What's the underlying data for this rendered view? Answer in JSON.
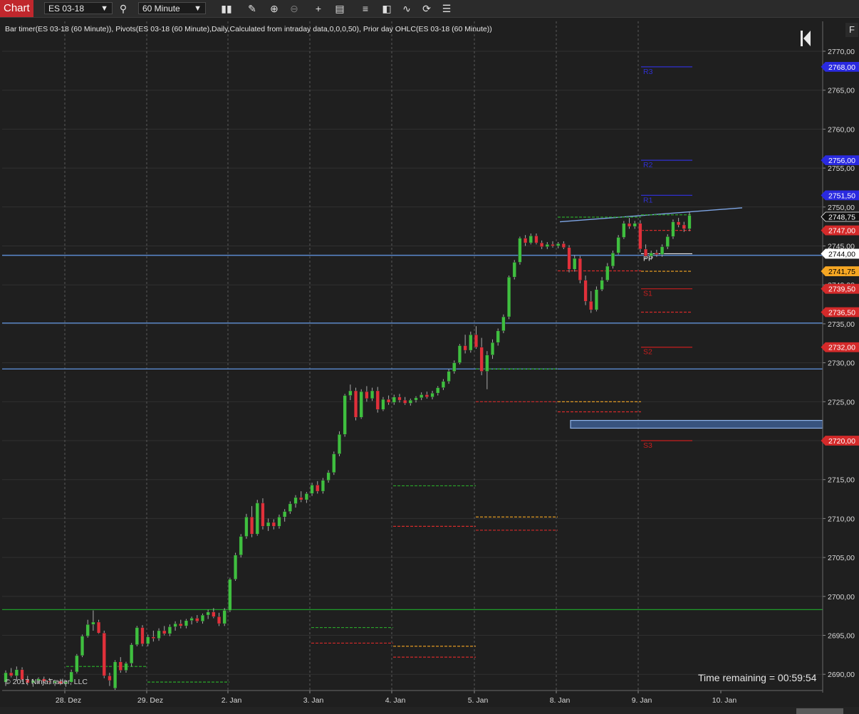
{
  "toolbar": {
    "tab_label": "Chart",
    "instrument": "ES 03-18",
    "interval": "60 Minute",
    "icons": [
      "search-icon",
      "bar-type-icon",
      "drawing-pencil-icon",
      "zoom-in-icon",
      "zoom-out-icon",
      "crosshair-icon",
      "properties-icon",
      "chart-trader-icon",
      "templates-icon",
      "strategies-icon",
      "refresh-icon",
      "data-list-icon"
    ]
  },
  "indicator_header": "Bar timer(ES 03-18 (60 Minute)), Pivots(ES 03-18 (60 Minute),Daily,Calculated from intraday data,0,0,0,50), Prior day OHLC(ES 03-18 (60 Minute))",
  "time_remaining": "Time remaining = 00:59:54",
  "copyright": "© 2017 NinjaTrader, LLC",
  "f_button": "F",
  "colors": {
    "up": "#3fbf3f",
    "down": "#e0303a",
    "pivot_r": "#3030d0",
    "pivot_s": "#c81e1e",
    "pivot_pp": "#e6e6e6",
    "hline": "#5b8bd0",
    "green_line": "#1f9c2a",
    "orange": "#f5a623",
    "grid": "#303030"
  },
  "chart_data": {
    "type": "candlestick",
    "ylim": [
      2688,
      2772
    ],
    "y_ticks": [
      "2770,00",
      "2765,00",
      "2760,00",
      "2755,00",
      "2750,00",
      "2745,00",
      "2740,00",
      "2735,00",
      "2730,00",
      "2725,00",
      "2720,00",
      "2715,00",
      "2710,00",
      "2705,00",
      "2700,00",
      "2695,00",
      "2690,00"
    ],
    "x_ticks": [
      "28. Dez",
      "29. Dez",
      "2. Jan",
      "3. Jan",
      "4. Jan",
      "5. Jan",
      "8. Jan",
      "9. Jan",
      "10. Jan"
    ],
    "price_markers": [
      {
        "value": 2768.0,
        "label": "2768,00",
        "color": "#2a2ae0",
        "text": "#ffffff"
      },
      {
        "value": 2756.0,
        "label": "2756,00",
        "color": "#2a2ae0",
        "text": "#ffffff"
      },
      {
        "value": 2751.5,
        "label": "2751,50",
        "color": "#2a2ae0",
        "text": "#ffffff"
      },
      {
        "value": 2748.75,
        "label": "2748,75",
        "color": "#111111",
        "text": "#ffffff",
        "border": "#ffffff"
      },
      {
        "value": 2747.0,
        "label": "2747,00",
        "color": "#d42a2a",
        "text": "#ffffff"
      },
      {
        "value": 2744.0,
        "label": "2744,00",
        "color": "#ffffff",
        "text": "#000000"
      },
      {
        "value": 2741.75,
        "label": "2741,75",
        "color": "#f5a623",
        "text": "#000000"
      },
      {
        "value": 2739.5,
        "label": "2739,50",
        "color": "#d42a2a",
        "text": "#ffffff"
      },
      {
        "value": 2736.5,
        "label": "2736,50",
        "color": "#d42a2a",
        "text": "#ffffff"
      },
      {
        "value": 2732.0,
        "label": "2732,00",
        "color": "#d42a2a",
        "text": "#ffffff"
      },
      {
        "value": 2720.0,
        "label": "2720,00",
        "color": "#d42a2a",
        "text": "#ffffff"
      }
    ],
    "pivot_labels": [
      {
        "label": "R3",
        "value": 2768.0
      },
      {
        "label": "R2",
        "value": 2756.0
      },
      {
        "label": "R1",
        "value": 2751.5
      },
      {
        "label": "PP",
        "value": 2744.0
      },
      {
        "label": "S1",
        "value": 2739.5
      },
      {
        "label": "S2",
        "value": 2732.0
      },
      {
        "label": "S3",
        "value": 2720.0
      }
    ],
    "horizontal_lines": [
      2743.8,
      2735.1,
      2729.2
    ],
    "green_line": 2698.3,
    "zone": {
      "from": 2721.6,
      "to": 2722.6
    },
    "trendline": {
      "from": 2748.1,
      "to": 2749.9
    },
    "candles": [
      [
        2689.0,
        2690.5,
        2688.5,
        2690.2
      ],
      [
        2690.2,
        2690.8,
        2689.6,
        2689.8
      ],
      [
        2689.8,
        2691.0,
        2689.2,
        2690.6
      ],
      [
        2690.6,
        2690.9,
        2689.0,
        2689.3
      ],
      [
        2689.3,
        2689.8,
        2688.6,
        2688.9
      ],
      [
        2688.9,
        2689.4,
        2688.4,
        2689.2
      ],
      [
        2689.2,
        2689.6,
        2688.8,
        2689.4
      ],
      [
        2689.4,
        2689.7,
        2688.9,
        2689.1
      ],
      [
        2689.1,
        2689.5,
        2688.7,
        2689.0
      ],
      [
        2688.9,
        2689.3,
        2688.5,
        2689.1
      ],
      [
        2689.1,
        2689.4,
        2688.6,
        2688.8
      ],
      [
        2688.8,
        2689.2,
        2688.4,
        2689.0
      ],
      [
        2689.0,
        2690.6,
        2688.9,
        2690.3
      ],
      [
        2690.3,
        2692.6,
        2690.1,
        2692.4
      ],
      [
        2692.4,
        2695.1,
        2692.2,
        2694.9
      ],
      [
        2694.9,
        2697.0,
        2694.7,
        2696.4
      ],
      [
        2696.4,
        2698.2,
        2695.6,
        2696.7
      ],
      [
        2696.7,
        2697.0,
        2695.2,
        2695.3
      ],
      [
        2695.3,
        2695.6,
        2689.5,
        2689.8
      ],
      [
        2689.8,
        2690.2,
        2688.5,
        2689.2
      ],
      [
        2688.2,
        2691.8,
        2688.0,
        2691.6
      ],
      [
        2691.6,
        2692.2,
        2690.2,
        2690.5
      ],
      [
        2690.5,
        2691.6,
        2690.2,
        2691.4
      ],
      [
        2691.4,
        2694.0,
        2691.0,
        2693.8
      ],
      [
        2693.8,
        2696.2,
        2693.6,
        2696.0
      ],
      [
        2696.0,
        2696.3,
        2693.6,
        2693.9
      ],
      [
        2693.9,
        2695.1,
        2693.6,
        2694.8
      ],
      [
        2694.8,
        2695.6,
        2694.2,
        2694.6
      ],
      [
        2694.6,
        2695.9,
        2694.3,
        2695.6
      ],
      [
        2695.6,
        2696.2,
        2695.0,
        2695.2
      ],
      [
        2695.2,
        2696.4,
        2694.9,
        2696.1
      ],
      [
        2696.1,
        2696.8,
        2695.6,
        2696.5
      ],
      [
        2696.5,
        2697.0,
        2695.9,
        2696.2
      ],
      [
        2696.2,
        2697.1,
        2695.9,
        2696.9
      ],
      [
        2696.9,
        2697.4,
        2696.4,
        2697.2
      ],
      [
        2697.2,
        2697.6,
        2696.6,
        2696.8
      ],
      [
        2696.8,
        2697.8,
        2696.5,
        2697.6
      ],
      [
        2697.6,
        2698.3,
        2697.1,
        2698.0
      ],
      [
        2698.0,
        2698.5,
        2697.2,
        2697.4
      ],
      [
        2697.4,
        2697.9,
        2696.2,
        2696.5
      ],
      [
        2696.5,
        2698.5,
        2696.2,
        2698.2
      ],
      [
        2698.2,
        2702.4,
        2698.0,
        2702.2
      ],
      [
        2702.2,
        2705.6,
        2702.0,
        2705.3
      ],
      [
        2705.3,
        2708.0,
        2705.0,
        2707.7
      ],
      [
        2707.7,
        2710.6,
        2707.4,
        2710.2
      ],
      [
        2710.2,
        2711.6,
        2707.6,
        2708.0
      ],
      [
        2708.0,
        2712.4,
        2707.8,
        2712.0
      ],
      [
        2712.0,
        2712.6,
        2708.6,
        2709.0
      ],
      [
        2709.0,
        2710.0,
        2708.4,
        2709.5
      ],
      [
        2709.5,
        2709.9,
        2708.6,
        2709.0
      ],
      [
        2709.0,
        2710.5,
        2708.7,
        2710.2
      ],
      [
        2710.2,
        2711.2,
        2709.6,
        2710.9
      ],
      [
        2710.9,
        2712.2,
        2710.6,
        2711.9
      ],
      [
        2711.9,
        2713.0,
        2711.4,
        2712.7
      ],
      [
        2712.7,
        2713.5,
        2712.1,
        2712.4
      ],
      [
        2712.4,
        2713.4,
        2712.0,
        2713.2
      ],
      [
        2713.2,
        2714.6,
        2712.9,
        2714.3
      ],
      [
        2714.3,
        2714.8,
        2713.2,
        2713.5
      ],
      [
        2713.5,
        2715.2,
        2713.2,
        2714.9
      ],
      [
        2714.9,
        2716.2,
        2714.6,
        2715.9
      ],
      [
        2715.9,
        2718.6,
        2715.6,
        2718.3
      ],
      [
        2718.3,
        2721.2,
        2718.0,
        2720.8
      ],
      [
        2720.8,
        2726.0,
        2720.5,
        2725.8
      ],
      [
        2725.8,
        2727.2,
        2725.2,
        2726.4
      ],
      [
        2726.4,
        2726.8,
        2722.6,
        2723.0
      ],
      [
        2723.0,
        2726.6,
        2722.8,
        2726.3
      ],
      [
        2726.3,
        2727.0,
        2725.0,
        2725.4
      ],
      [
        2725.4,
        2726.8,
        2725.1,
        2726.4
      ],
      [
        2726.4,
        2726.9,
        2723.6,
        2724.0
      ],
      [
        2724.0,
        2725.6,
        2723.8,
        2725.3
      ],
      [
        2725.3,
        2725.8,
        2724.6,
        2724.9
      ],
      [
        2724.9,
        2725.9,
        2724.6,
        2725.6
      ],
      [
        2725.6,
        2726.0,
        2724.9,
        2725.2
      ],
      [
        2725.2,
        2725.6,
        2724.6,
        2724.8
      ],
      [
        2724.8,
        2725.4,
        2724.5,
        2725.2
      ],
      [
        2725.2,
        2725.7,
        2724.9,
        2725.5
      ],
      [
        2725.5,
        2726.2,
        2725.2,
        2725.9
      ],
      [
        2725.9,
        2726.3,
        2725.4,
        2725.6
      ],
      [
        2725.6,
        2726.4,
        2725.3,
        2726.1
      ],
      [
        2726.1,
        2727.0,
        2725.8,
        2726.8
      ],
      [
        2726.8,
        2727.9,
        2726.5,
        2727.6
      ],
      [
        2727.6,
        2729.2,
        2727.3,
        2728.9
      ],
      [
        2728.9,
        2730.3,
        2728.6,
        2730.0
      ],
      [
        2730.0,
        2732.4,
        2729.8,
        2732.2
      ],
      [
        2732.2,
        2733.6,
        2731.2,
        2731.6
      ],
      [
        2731.6,
        2734.0,
        2731.3,
        2733.6
      ],
      [
        2733.6,
        2734.7,
        2731.8,
        2732.0
      ],
      [
        2732.0,
        2733.2,
        2728.4,
        2728.9
      ],
      [
        2728.9,
        2731.5,
        2726.6,
        2731.0
      ],
      [
        2731.0,
        2733.0,
        2730.5,
        2732.6
      ],
      [
        2732.6,
        2734.4,
        2732.2,
        2734.1
      ],
      [
        2734.1,
        2736.2,
        2733.8,
        2735.9
      ],
      [
        2735.9,
        2741.2,
        2735.6,
        2741.0
      ],
      [
        2741.0,
        2743.2,
        2740.7,
        2742.9
      ],
      [
        2742.9,
        2746.2,
        2742.6,
        2746.0
      ],
      [
        2746.0,
        2746.4,
        2745.0,
        2745.4
      ],
      [
        2745.4,
        2746.6,
        2745.2,
        2746.3
      ],
      [
        2746.3,
        2746.6,
        2745.2,
        2745.4
      ],
      [
        2745.4,
        2745.7,
        2744.6,
        2744.9
      ],
      [
        2744.9,
        2745.5,
        2744.6,
        2745.2
      ],
      [
        2745.2,
        2745.6,
        2744.8,
        2745.0
      ],
      [
        2745.0,
        2745.5,
        2744.7,
        2745.3
      ],
      [
        2745.3,
        2745.6,
        2744.6,
        2744.8
      ],
      [
        2744.8,
        2745.1,
        2741.6,
        2742.0
      ],
      [
        2742.0,
        2743.8,
        2741.7,
        2743.4
      ],
      [
        2743.4,
        2743.7,
        2740.2,
        2740.6
      ],
      [
        2740.6,
        2741.2,
        2737.4,
        2737.9
      ],
      [
        2737.9,
        2739.2,
        2736.4,
        2736.8
      ],
      [
        2736.8,
        2739.8,
        2736.6,
        2739.4
      ],
      [
        2739.4,
        2741.0,
        2739.2,
        2740.6
      ],
      [
        2740.6,
        2742.8,
        2740.4,
        2742.4
      ],
      [
        2742.4,
        2744.4,
        2742.1,
        2744.1
      ],
      [
        2744.1,
        2746.4,
        2743.9,
        2746.1
      ],
      [
        2746.1,
        2748.2,
        2745.9,
        2747.9
      ],
      [
        2747.9,
        2748.6,
        2747.2,
        2747.5
      ],
      [
        2747.5,
        2748.2,
        2747.2,
        2747.9
      ],
      [
        2747.9,
        2748.3,
        2744.2,
        2744.6
      ],
      [
        2744.6,
        2745.2,
        2743.4,
        2743.7
      ],
      [
        2743.7,
        2744.4,
        2743.2,
        2744.1
      ],
      [
        2744.1,
        2744.5,
        2743.6,
        2743.9
      ],
      [
        2743.9,
        2745.2,
        2743.6,
        2744.9
      ],
      [
        2744.9,
        2746.5,
        2744.6,
        2746.2
      ],
      [
        2746.2,
        2748.4,
        2745.9,
        2748.1
      ],
      [
        2748.1,
        2748.6,
        2747.4,
        2747.7
      ],
      [
        2747.7,
        2748.1,
        2746.8,
        2747.2
      ],
      [
        2747.2,
        2749.4,
        2746.9,
        2748.9
      ]
    ]
  }
}
